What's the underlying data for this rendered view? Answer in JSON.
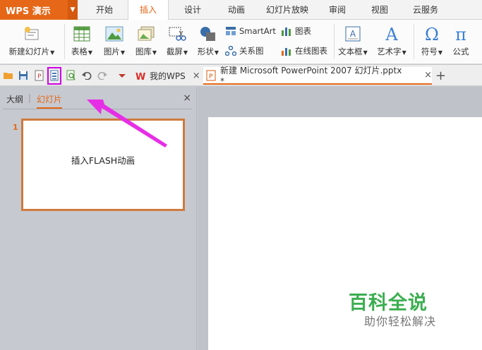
{
  "app": {
    "name": "WPS 演示"
  },
  "menu": {
    "tabs": [
      {
        "label": "开始"
      },
      {
        "label": "插入"
      },
      {
        "label": "设计"
      },
      {
        "label": "动画"
      },
      {
        "label": "幻灯片放映"
      },
      {
        "label": "审阅"
      },
      {
        "label": "视图"
      },
      {
        "label": "云服务"
      }
    ],
    "active": "插入"
  },
  "ribbon": {
    "new_slide": "新建幻灯片",
    "table": "表格",
    "picture": "图片",
    "gallery": "图库",
    "screenshot": "截屏",
    "shape": "形状",
    "smartart": "SmartArt",
    "chart": "图表",
    "relation": "关系图",
    "online_chart": "在线图表",
    "textbox": "文本框",
    "wordart": "艺术字",
    "symbol": "符号",
    "formula": "公式"
  },
  "doc_tabs": [
    {
      "label": "我的WPS"
    },
    {
      "label": "新建 Microsoft PowerPoint 2007 幻灯片.pptx *"
    }
  ],
  "new_tab": "+",
  "left_panel": {
    "tab_outline": "大纲",
    "divider": "|",
    "tab_slides": "幻灯片",
    "close": "×",
    "slide_number": "1",
    "slide_thumb_text": "插入FLASH动画"
  },
  "watermark": {
    "title": "百科全说",
    "subtitle": "助你轻松解决"
  },
  "colors": {
    "accent": "#e56717",
    "highlight": "#d100e6",
    "arrow": "#e62ee6",
    "watermark_green": "#3bae50"
  }
}
